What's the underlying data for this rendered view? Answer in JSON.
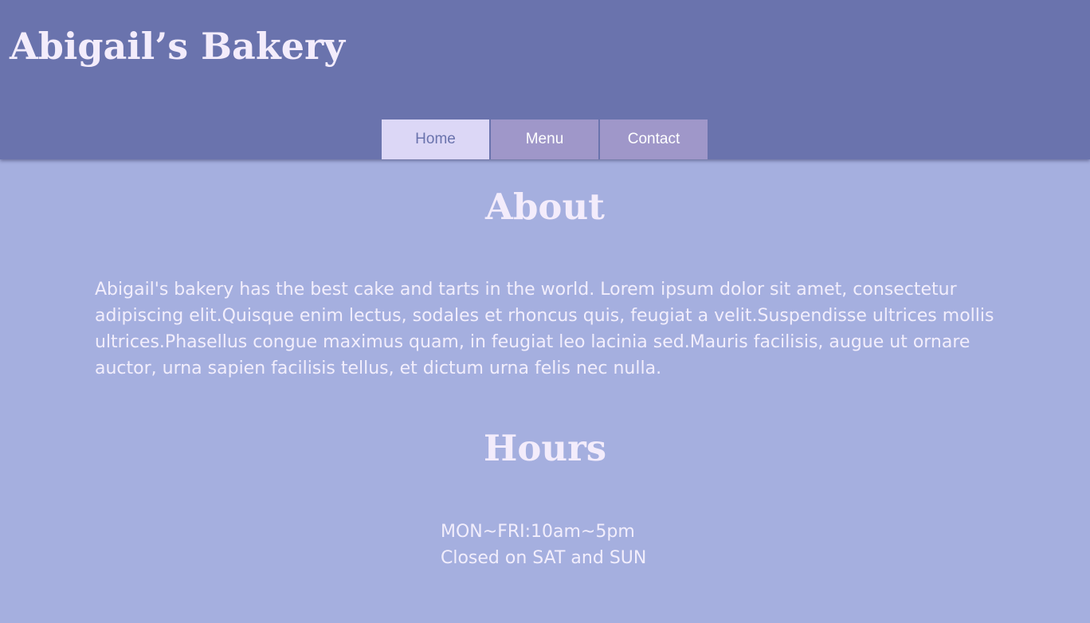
{
  "header": {
    "title": "Abigail’s Bakery"
  },
  "nav": {
    "items": [
      {
        "label": "Home",
        "active": true
      },
      {
        "label": "Menu",
        "active": false
      },
      {
        "label": "Contact",
        "active": false
      }
    ]
  },
  "about": {
    "heading": "About",
    "text": "Abigail's bakery has the best cake and tarts in the world. Lorem ipsum dolor sit amet, consectetur adipiscing elit.Quisque enim lectus, sodales et rhoncus quis, feugiat a velit.Suspendisse ultrices mollis ultrices.Phasellus congue maximus quam, in feugiat leo lacinia sed.Mauris facilisis, augue ut ornare auctor, urna sapien facilisis tellus, et dictum urna felis nec nulla."
  },
  "hours": {
    "heading": "Hours",
    "lines": [
      "MON~FRI:10am~5pm",
      "Closed on SAT and SUN"
    ]
  },
  "colors": {
    "header_bg": "#6a73ad",
    "page_bg": "#a5afdf",
    "tab_active_bg": "#dcd7f6",
    "tab_bg": "#9f97c9",
    "text_light": "#f3ecfb"
  }
}
